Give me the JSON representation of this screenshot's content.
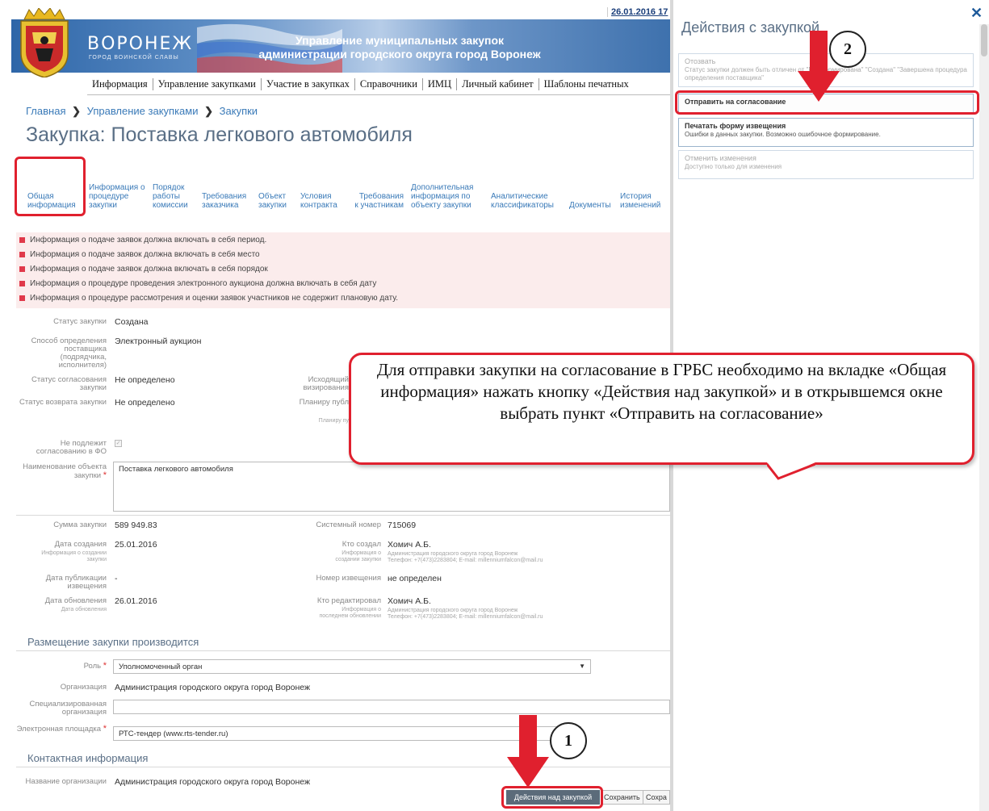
{
  "header": {
    "date": "26.01.2016 17",
    "city_name": "ВОРОНЕЖ",
    "city_subtitle": "ГОРОД ВОИНСКОЙ СЛАВЫ",
    "title_line1": "Управление муниципальных закупок",
    "title_line2": "администрации городского округа город Воронеж"
  },
  "nav": {
    "items": [
      "Информация",
      "Управление закупками",
      "Участие в закупках",
      "Справочники",
      "ИМЦ",
      "Личный кабинет",
      "Шаблоны печатных"
    ]
  },
  "breadcrumb": {
    "home": "Главная",
    "sep": "❯",
    "section": "Управление закупками",
    "page": "Закупки"
  },
  "page_title": "Закупка: Поставка легкового автомобиля",
  "tabs": [
    {
      "label": "Общая информация"
    },
    {
      "label": "Информация о процедуре закупки"
    },
    {
      "label": "Порядок работы комиссии"
    },
    {
      "label": "Требования заказчика"
    },
    {
      "label": "Объект закупки"
    },
    {
      "label": "Условия контракта"
    },
    {
      "label": "Требования к участникам"
    },
    {
      "label": "Дополнительная информация по объекту закупки"
    },
    {
      "label": "Аналитические классификаторы"
    },
    {
      "label": "Документы"
    },
    {
      "label": "История изменений"
    }
  ],
  "messages": [
    "Информация о подаче заявок должна включать в себя период.",
    "Информация о подаче заявок должна включать в себя место",
    "Информация о подаче заявок должна включать в себя порядок",
    "Информация о процедуре проведения электронного аукциона должна включать в себя дату",
    "Информация о процедуре рассмотрения и оценки заявок участников не содержит плановую дату."
  ],
  "fields": {
    "status_label": "Статус закупки",
    "status_value": "Создана",
    "method_label": "Способ определения поставщика (подрядчика, исполнителя)",
    "method_value": "Электронный аукцион",
    "approval_label": "Статус согласования закупки",
    "approval_value": "Не определено",
    "return_label": "Статус возврата закупки",
    "return_value": "Не определено",
    "outgoing_label": "Исходящий визирования",
    "planned_label": "Планиру публ",
    "planned_sub": "Планиру пу",
    "fo_label": "Не подлежит согласованию в ФО",
    "name_label": "Наименование объекта закупки",
    "name_value": "Поставка легкового автомобиля",
    "sum_label": "Сумма закупки",
    "sum_value": "589 949.83",
    "sysnum_label": "Системный номер",
    "sysnum_value": "715069",
    "created_label": "Дата создания",
    "created_sub": "Информация о создании закупки",
    "created_value": "25.01.2016",
    "creator_label": "Кто создал",
    "creator_sub": "Информация о создании закупки",
    "creator_value": "Хомич А.Б.",
    "creator_org": "Администрация городского округа город Воронеж",
    "creator_contact": "Телефон: +7(473)2283804; E-mail: millenniumfalcon@mail.ru",
    "pub_label": "Дата публикации извещения",
    "pub_value": "-",
    "notice_label": "Номер извещения",
    "notice_value": "не определен",
    "updated_label": "Дата обновления",
    "updated_sub": "Дата обновления",
    "updated_value": "26.01.2016",
    "editor_label": "Кто редактировал",
    "editor_sub": "Информация о последнем обновлении",
    "editor_value": "Хомич А.Б.",
    "editor_org": "Администрация городского округа город Воронеж",
    "editor_contact": "Телефон: +7(473)2283804; E-mail: millenniumfalcon@mail.ru"
  },
  "placement": {
    "section_title": "Размещение закупки производится",
    "role_label": "Роль",
    "role_value": "Уполномоченный орган",
    "org_label": "Организация",
    "org_value": "Администрация городского округа город Воронеж",
    "spec_label": "Специализированная организация",
    "spec_value": "",
    "platform_label": "Электронная площадка",
    "platform_value": "РТС-тендер (www.rts-tender.ru)"
  },
  "contact": {
    "section_title": "Контактная информация",
    "orgname_label": "Название организации",
    "orgname_value": "Администрация городского округа город Воронеж"
  },
  "buttons": {
    "actions": "Действия над закупкой",
    "save": "Сохранить",
    "save2": "Сохра"
  },
  "panel": {
    "title": "Действия с закупкой",
    "items": [
      {
        "title": "Отозвать",
        "desc": "Статус закупки должен быть отличен от \"Расформирована\" \"Создана\" \"Завершена процедура определения поставщика\""
      },
      {
        "title": "Отправить на согласование",
        "desc": ""
      },
      {
        "title": "Печатать форму извещения",
        "desc": "Ошибки в данных закупки. Возможно ошибочное формирование."
      },
      {
        "title": "Отменить изменения",
        "desc": "Доступно только для изменения"
      }
    ]
  },
  "annotation": {
    "callout": "Для отправки закупки на согласование в ГРБС необходимо на вкладке «Общая информация» нажать кнопку «Действия над закупкой» и в открывшемся окне выбрать пункт «Отправить на согласование»",
    "step1": "1",
    "step2": "2"
  },
  "colors": {
    "highlight": "#e0202e",
    "link": "#3a7ab8",
    "error_bg": "#fbecec"
  }
}
